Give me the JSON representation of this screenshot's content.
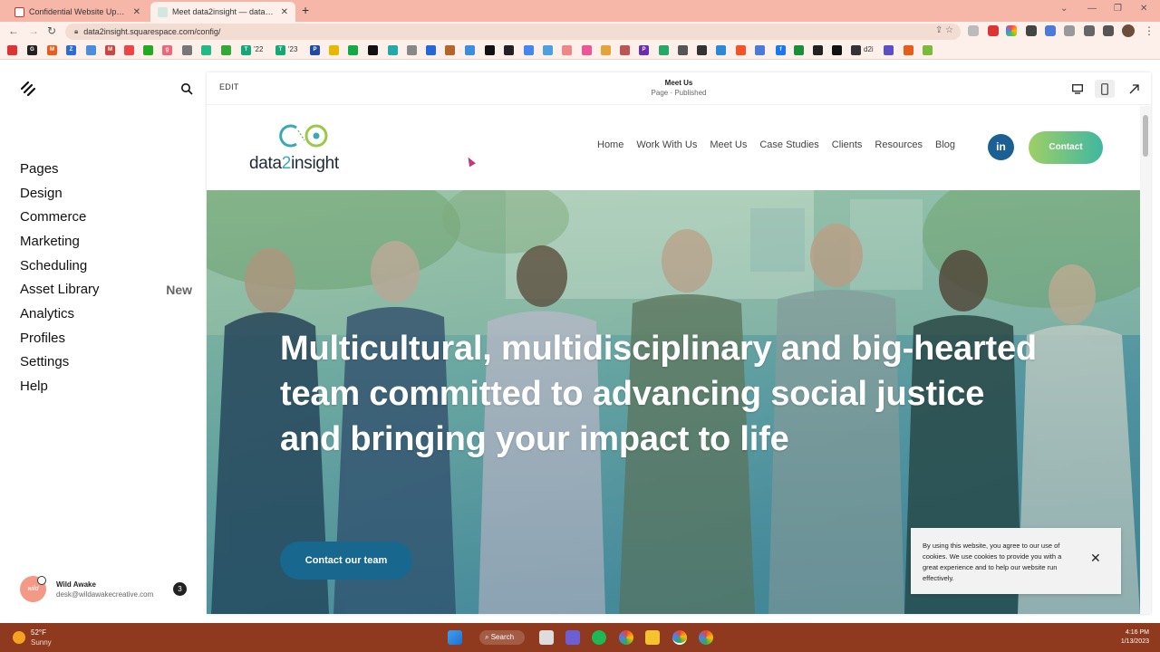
{
  "browser": {
    "tabs": [
      {
        "title": "Confidential Website Update - c",
        "active": false
      },
      {
        "title": "Meet data2insight — data2insigh",
        "active": true
      }
    ],
    "url": "data2insight.squarespace.com/config/",
    "bookmarks": [
      "'22",
      "'23",
      "d2i"
    ]
  },
  "sidebar": {
    "items": [
      {
        "label": "Pages"
      },
      {
        "label": "Design"
      },
      {
        "label": "Commerce"
      },
      {
        "label": "Marketing"
      },
      {
        "label": "Scheduling"
      },
      {
        "label": "Asset Library",
        "badge": "New"
      },
      {
        "label": "Analytics"
      },
      {
        "label": "Profiles"
      },
      {
        "label": "Settings"
      },
      {
        "label": "Help"
      }
    ],
    "account": {
      "name": "Wild Awake",
      "email": "desk@wildawakecreative.com",
      "notifications": "3",
      "avatar_text": "wild"
    }
  },
  "editor": {
    "edit_label": "EDIT",
    "page_title": "Meet Us",
    "page_status": "Page · Published"
  },
  "site": {
    "logo": {
      "prefix": "data",
      "two": "2",
      "suffix": "insight"
    },
    "menu": [
      "Home",
      "Work With Us",
      "Meet Us",
      "Case Studies",
      "Clients",
      "Resources",
      "Blog"
    ],
    "linkedin_label": "in",
    "contact_label": "Contact",
    "hero_title": "Multicultural, multidisciplinary and big-hearted team committed to advancing social justice and bringing your impact to life",
    "hero_cta": "Contact our team",
    "cookie_text": "By using this website, you agree to our use of cookies. We use cookies to provide you with a great experience and to help our website run effectively.",
    "cookie_close": "✕"
  },
  "taskbar": {
    "temperature": "52°F",
    "weather": "Sunny",
    "search_label": "Search",
    "time": "4:16 PM",
    "date": "1/13/2023"
  },
  "colors": {
    "tabbar": "#f6b7a8",
    "brand_blue": "#17678e",
    "brand_green": "#9fcf66",
    "taskbar": "#8f3a1f"
  }
}
